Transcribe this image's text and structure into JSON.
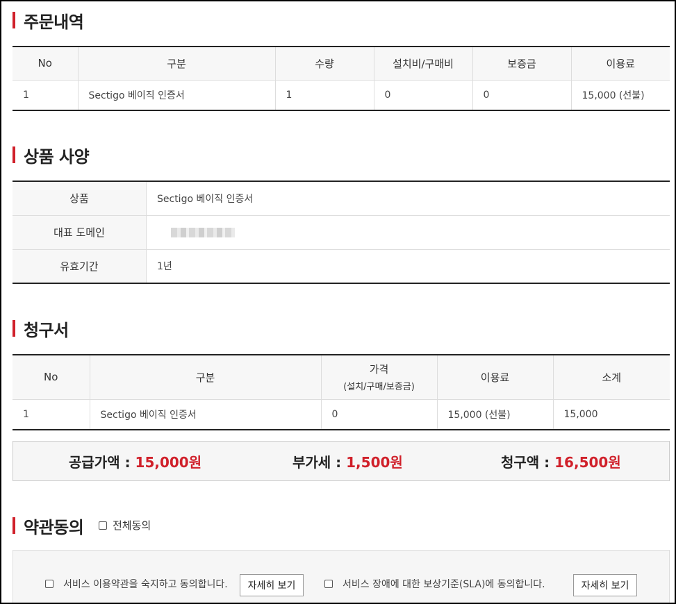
{
  "order": {
    "title": "주문내역",
    "headers": [
      "No",
      "구분",
      "수량",
      "설치비/구매비",
      "보증금",
      "이용료"
    ],
    "rows": [
      [
        "1",
        "Sectigo 베이직 인증서",
        "1",
        "0",
        "0",
        "15,000 (선불)"
      ]
    ]
  },
  "spec": {
    "title": "상품 사양",
    "rows": [
      {
        "label": "상품",
        "value": "Sectigo 베이직 인증서"
      },
      {
        "label": "대표 도메인",
        "value": ""
      },
      {
        "label": "유효기간",
        "value": "1년"
      }
    ]
  },
  "invoice": {
    "title": "청구서",
    "headers": [
      "No",
      "구분",
      "가격",
      "(설치/구매/보증금)",
      "이용료",
      "소계"
    ],
    "rows": [
      [
        "1",
        "Sectigo 베이직 인증서",
        "0",
        "15,000 (선불)",
        "15,000"
      ]
    ]
  },
  "summary": {
    "supply_label": "공급가액 :",
    "supply_value": "15,000원",
    "vat_label": "부가세 :",
    "vat_value": "1,500원",
    "total_label": "청구액 :",
    "total_value": "16,500원"
  },
  "terms": {
    "title": "약관동의",
    "all_label": "전체동의",
    "item1_label": "서비스 이용약관을 숙지하고 동의합니다.",
    "item1_button": "자세히 보기",
    "item2_label": "서비스 장애에 대한 보상기준(SLA)에 동의합니다.",
    "item2_button": "자세히 보기"
  },
  "colors": {
    "accent": "#d0202a",
    "header_bg": "#f7f7f7",
    "border_dark": "#222222"
  }
}
